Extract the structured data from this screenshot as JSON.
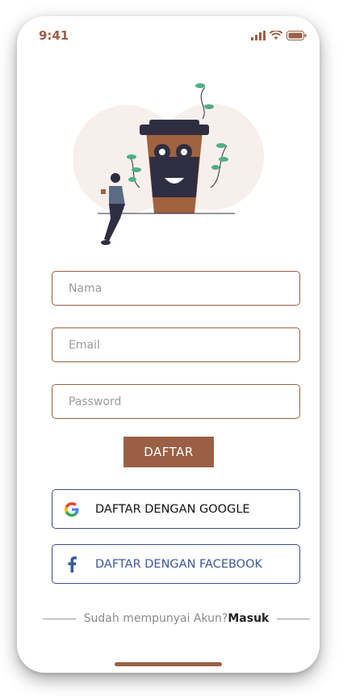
{
  "status_bar": {
    "time": "9:41"
  },
  "form": {
    "name_placeholder": "Nama",
    "email_placeholder": "Email",
    "password_placeholder": "Password",
    "submit_label": "DAFTAR"
  },
  "social": {
    "google_label": "DAFTAR DENGAN GOOGLE",
    "facebook_label": "DAFTAR DENGAN FACEBOOK"
  },
  "footer": {
    "prompt": "Sudah mempunyai Akun?",
    "login_link": "Masuk"
  },
  "colors": {
    "accent": "#9a5f44",
    "facebook": "#3b5998",
    "border_social": "#3b4f8c"
  },
  "icons": [
    "signal-icon",
    "wifi-icon",
    "battery-icon",
    "google-icon",
    "facebook-icon"
  ]
}
